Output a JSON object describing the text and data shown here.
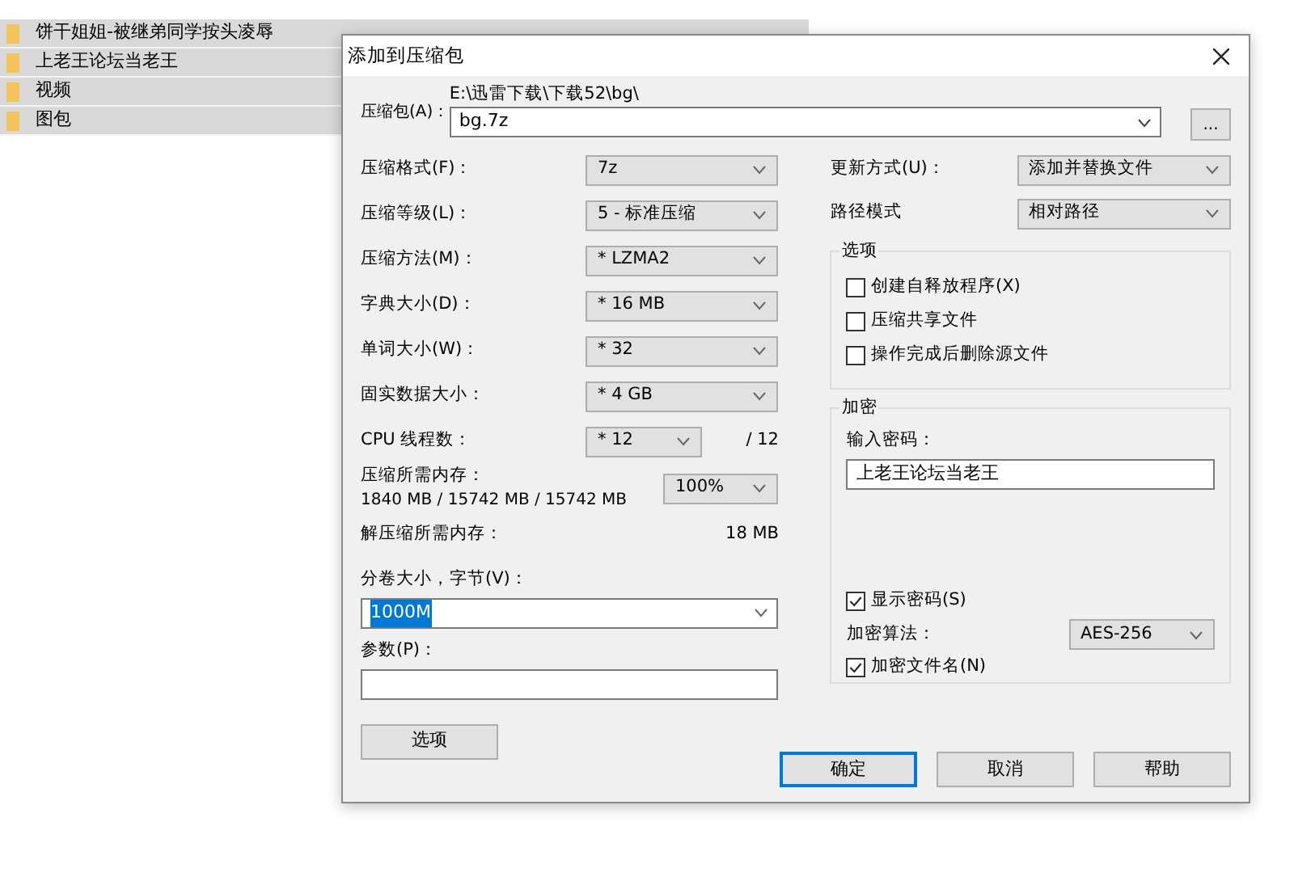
{
  "file_list": [
    {
      "name": "饼干姐姐-被继弟同学按头凌辱"
    },
    {
      "name": "上老王论坛当老王"
    },
    {
      "name": "视频"
    },
    {
      "name": "图包"
    }
  ],
  "dialog": {
    "title": "添加到压缩包",
    "archive": {
      "label": "压缩包(A)：",
      "path": "E:\\迅雷下载\\下载52\\bg\\",
      "value": "bg.7z",
      "browse": "..."
    },
    "left_fields": [
      {
        "kind": "select",
        "label": "压缩格式(F)：",
        "value": "7z"
      },
      {
        "kind": "select",
        "label": "压缩等级(L)：",
        "value": "5 - 标准压缩"
      },
      {
        "kind": "select",
        "label": "压缩方法(M)：",
        "value": "* LZMA2"
      },
      {
        "kind": "select",
        "label": "字典大小(D)：",
        "value": "* 16 MB"
      },
      {
        "kind": "select",
        "label": "单词大小(W)：",
        "value": "* 32"
      },
      {
        "kind": "select",
        "label": "固实数据大小：",
        "value": "* 4 GB"
      },
      {
        "kind": "threads",
        "label": "CPU 线程数：",
        "value": "* 12",
        "extra": "/ 12"
      },
      {
        "kind": "memory",
        "label": "压缩所需内存：",
        "detail": "1840 MB / 15742 MB / 15742 MB",
        "value": "100%"
      },
      {
        "kind": "info",
        "label": "解压缩所需内存：",
        "extra": "18 MB"
      }
    ],
    "volume": {
      "label": "分卷大小，字节(V)：",
      "value": "1000M",
      "text_selected": true
    },
    "params": {
      "label": "参数(P)："
    },
    "options_button": "选项",
    "right_fields": [
      {
        "label": "更新方式(U)：",
        "value": "添加并替换文件"
      },
      {
        "label": "路径模式",
        "value": "相对路径"
      }
    ],
    "options_group": {
      "title": "选项",
      "items": [
        {
          "label": "创建自释放程序(X)",
          "checked": false
        },
        {
          "label": "压缩共享文件",
          "checked": false
        },
        {
          "label": "操作完成后删除源文件",
          "checked": false
        }
      ]
    },
    "encryption": {
      "title": "加密",
      "password_label": "输入密码：",
      "password": "上老王论坛当老王",
      "show_password": {
        "label": "显示密码(S)",
        "checked": true
      },
      "method_label": "加密算法：",
      "method": "AES-256",
      "encrypt_names": {
        "label": "加密文件名(N)",
        "checked": true
      }
    },
    "buttons": [
      {
        "label": "确定",
        "default": true
      },
      {
        "label": "取消",
        "default": false
      },
      {
        "label": "帮助",
        "default": false
      }
    ]
  }
}
